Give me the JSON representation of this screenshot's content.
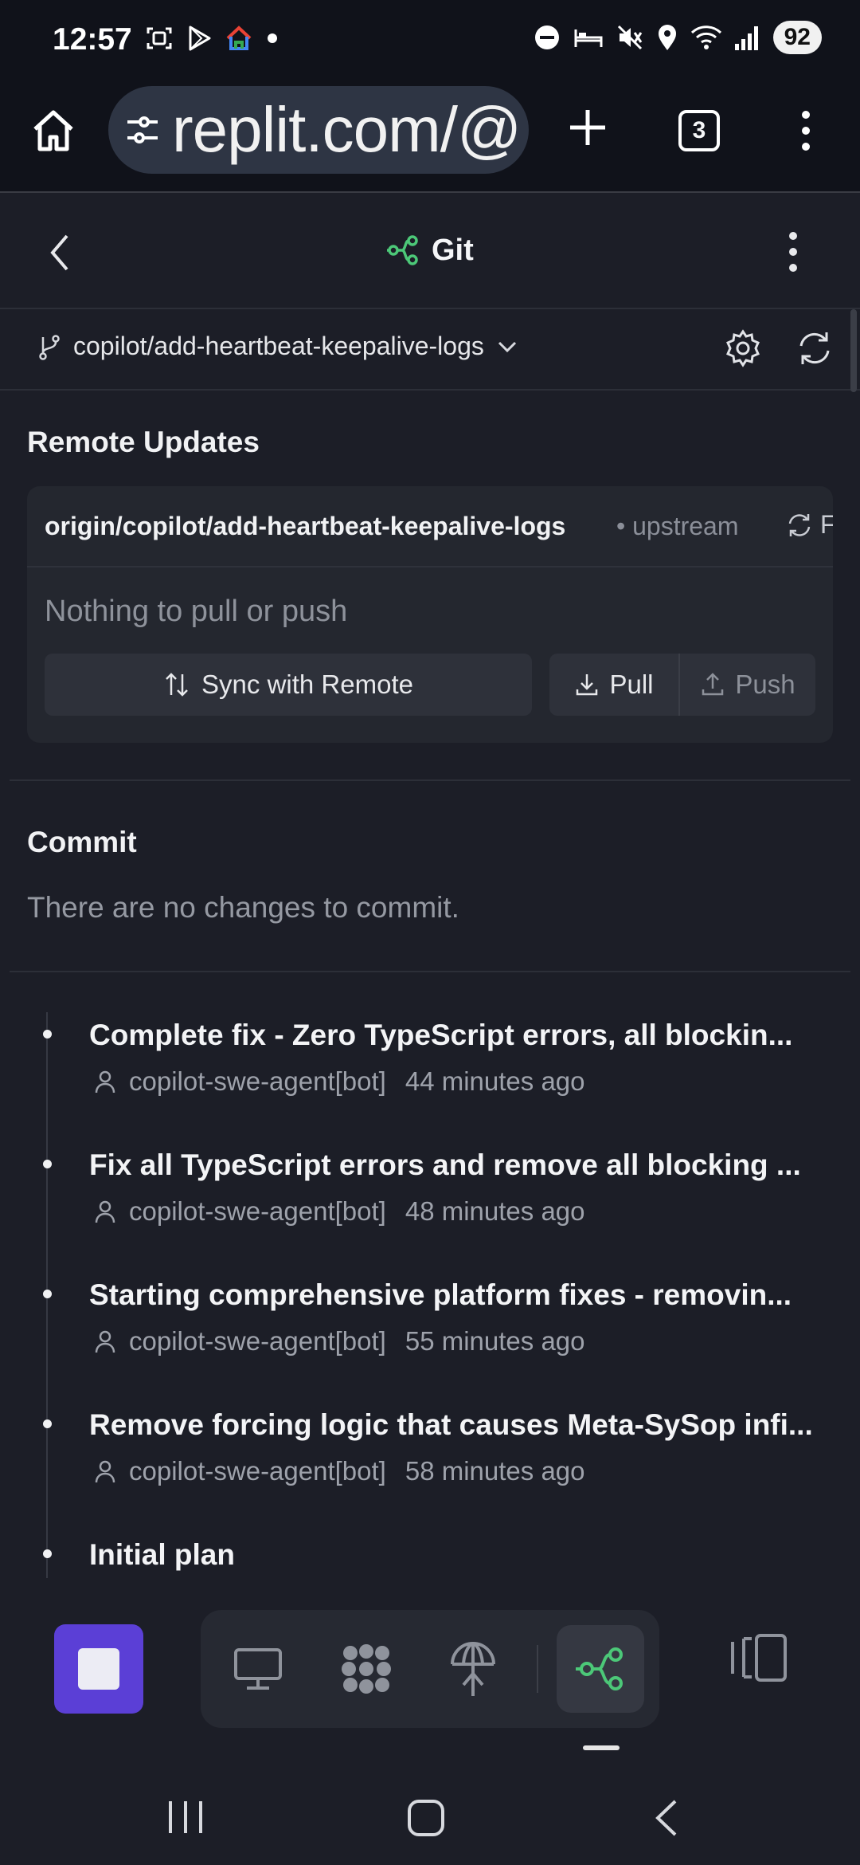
{
  "status_bar": {
    "time": "12:57",
    "battery": "92",
    "left_icons": [
      "screenshot-icon",
      "play-store-icon",
      "home-app-icon",
      "notification-dot-icon"
    ],
    "right_icons": [
      "do-not-disturb-icon",
      "sleep-icon",
      "mute-icon",
      "location-icon",
      "wifi-icon",
      "signal-icon"
    ]
  },
  "browser": {
    "url": "replit.com/@",
    "tab_count": "3"
  },
  "header": {
    "title": "Git"
  },
  "branch": {
    "name": "copilot/add-heartbeat-keepalive-logs"
  },
  "remote_updates": {
    "title": "Remote Updates",
    "remote_branch": "origin/copilot/add-heartbeat-keepalive-logs",
    "upstream_label": "• upstream",
    "fetch_label": "Fetch",
    "status": "Nothing to pull or push",
    "sync_label": "Sync with Remote",
    "pull_label": "Pull",
    "push_label": "Push"
  },
  "commit_section": {
    "title": "Commit",
    "empty_message": "There are no changes to commit."
  },
  "commits": [
    {
      "message": "Complete fix - Zero TypeScript errors, all blockin...",
      "author": "copilot-swe-agent[bot]",
      "time": "44 minutes ago"
    },
    {
      "message": "Fix all TypeScript errors and remove all blocking ...",
      "author": "copilot-swe-agent[bot]",
      "time": "48 minutes ago"
    },
    {
      "message": "Starting comprehensive platform fixes - removin...",
      "author": "copilot-swe-agent[bot]",
      "time": "55 minutes ago"
    },
    {
      "message": "Remove forcing logic that causes Meta-SySop infi...",
      "author": "copilot-swe-agent[bot]",
      "time": "58 minutes ago"
    },
    {
      "message": "Initial plan",
      "author": "",
      "time": ""
    }
  ],
  "toolbar": {
    "tools": [
      "desktop-icon",
      "extensions-icon",
      "deployments-icon",
      "git-icon"
    ],
    "active_tool": "git-icon"
  },
  "colors": {
    "background": "#1c1e27",
    "accent_green": "#4cc878",
    "stop_button": "#5b3fd6"
  }
}
